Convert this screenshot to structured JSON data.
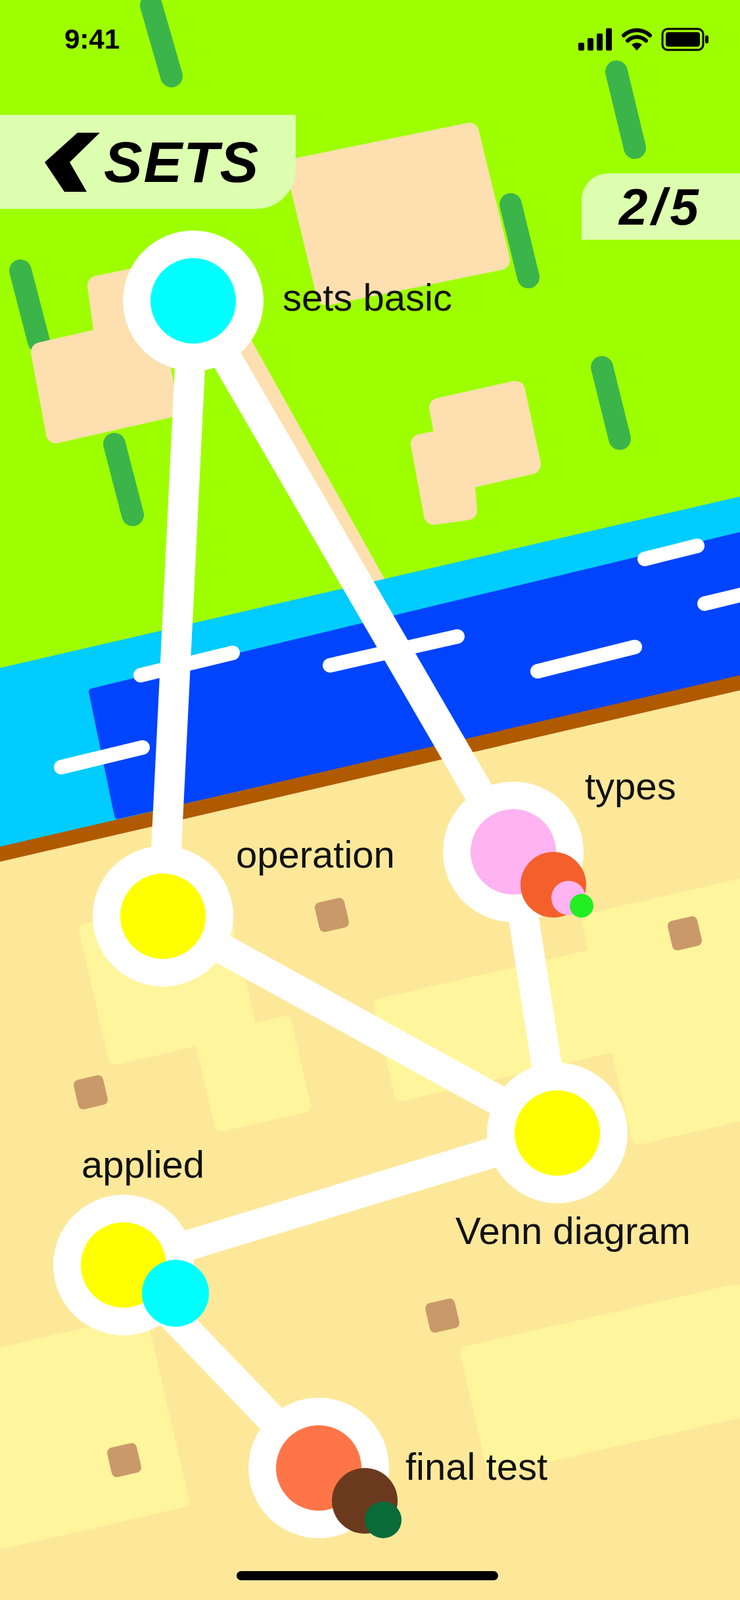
{
  "status_bar": {
    "time": "9:41"
  },
  "header": {
    "back_label": "SETS",
    "progress": "2/5"
  },
  "nodes": [
    {
      "label": "sets basic",
      "color": "#00FFFF",
      "badges": []
    },
    {
      "label": "types",
      "color": "#FFB3F0",
      "badges": [
        {
          "color": "#F4602C"
        },
        {
          "color": "#FFB3F0"
        },
        {
          "color": "#22EE22"
        }
      ]
    },
    {
      "label": "operation",
      "color": "#FFFF00",
      "badges": []
    },
    {
      "label": "Venn diagram",
      "color": "#FFFF00",
      "badges": []
    },
    {
      "label": "applied",
      "color": "#FFFF00",
      "badges": [
        {
          "color": "#00FFFF"
        }
      ]
    },
    {
      "label": "final test",
      "color": "#FF7548",
      "badges": [
        {
          "color": "#6B3A1E"
        },
        {
          "color": "#0A6B3A"
        }
      ]
    }
  ],
  "edges": [
    {
      "from": 0,
      "to": 2
    },
    {
      "from": 0,
      "to": 1
    },
    {
      "from": 2,
      "to": 3
    },
    {
      "from": 1,
      "to": 3
    },
    {
      "from": 3,
      "to": 4
    },
    {
      "from": 4,
      "to": 5
    }
  ]
}
